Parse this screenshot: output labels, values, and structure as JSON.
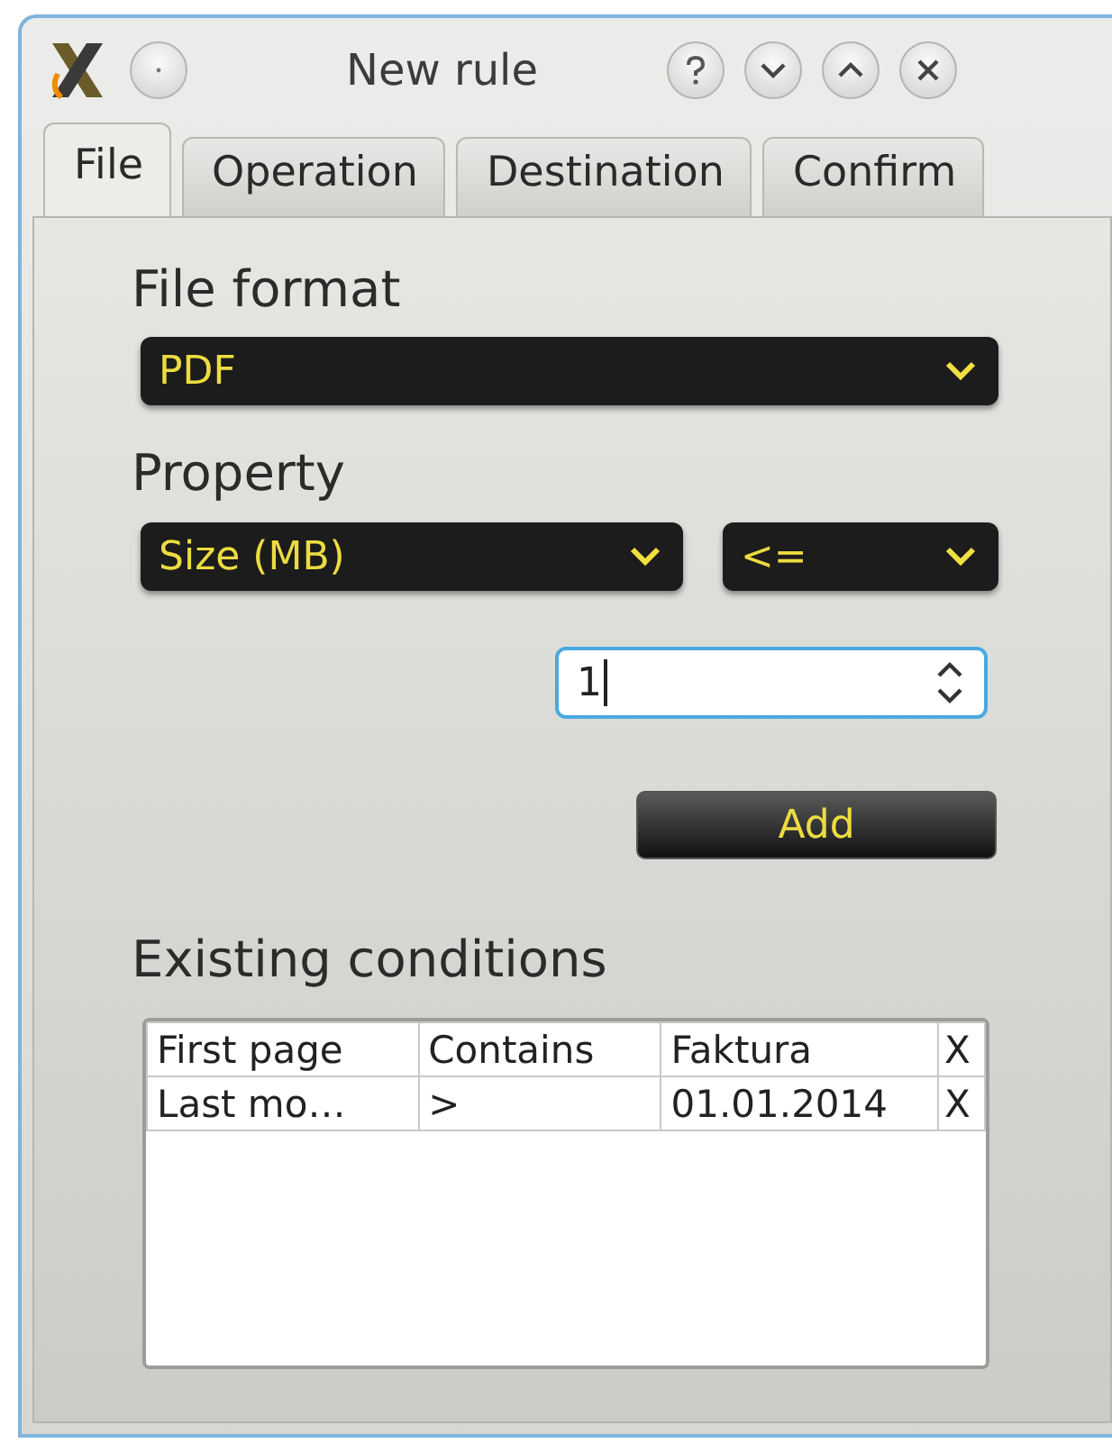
{
  "window": {
    "title": "New rule"
  },
  "tabs": [
    {
      "label": "File",
      "selected": true
    },
    {
      "label": "Operation",
      "selected": false
    },
    {
      "label": "Destination",
      "selected": false
    },
    {
      "label": "Confirm",
      "selected": false
    }
  ],
  "file_format": {
    "label": "File format",
    "value": "PDF"
  },
  "property": {
    "label": "Property",
    "field": "Size (MB)",
    "operator": "<=",
    "value": "1"
  },
  "add_button": "Add",
  "conditions": {
    "label": "Existing conditions",
    "rows": [
      [
        "First page",
        "Contains",
        "Faktura",
        "X"
      ],
      [
        "Last mo…",
        ">",
        "01.01.2014",
        "X"
      ]
    ]
  }
}
